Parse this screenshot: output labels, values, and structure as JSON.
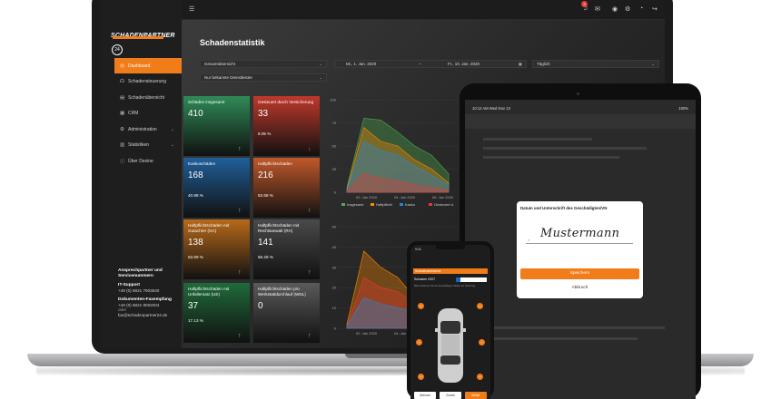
{
  "app": {
    "brand_name": "SCHADENPARTNER",
    "brand_badge": "24",
    "page_title": "Schadenstatistik"
  },
  "sidebar": {
    "items": [
      {
        "label": "Dashboard",
        "icon": "speedometer-icon",
        "glyph": "◷",
        "active": true
      },
      {
        "label": "Schadensteuerung",
        "icon": "headset-icon",
        "glyph": "☊",
        "active": false
      },
      {
        "label": "Schadenübersicht",
        "icon": "document-icon",
        "glyph": "▤",
        "active": false
      },
      {
        "label": "CRM",
        "icon": "contacts-icon",
        "glyph": "▦",
        "active": false
      },
      {
        "label": "Administration",
        "icon": "gear-icon",
        "glyph": "⚙",
        "active": false,
        "has_chevron": true
      },
      {
        "label": "Statistiken",
        "icon": "bar-chart-icon",
        "glyph": "▥",
        "active": false,
        "has_chevron": true
      },
      {
        "label": "Über Dexine",
        "icon": "info-icon",
        "glyph": "ⓘ",
        "active": false
      }
    ]
  },
  "contact": {
    "heading": "Ansprechpartner und Servicenummern",
    "it_label": "IT-Support",
    "it_phone": "+49 (0) 6821 7903540",
    "doc_label": "Dokumenten-Faxempfang",
    "doc_phone": "+49 (0) 6821 9002004",
    "or": "oder",
    "email": "fax@schadenpartner24.de"
  },
  "filters": {
    "overview": "Gesamtübersicht",
    "service": "Nur bekannte Dienstleister",
    "date_from": "Mi., 1. Jan. 2020",
    "date_sep": "–",
    "date_to": "Fr., 10. Jan. 2020",
    "interval": "Täglich"
  },
  "kpis": [
    {
      "title": "Schäden insgesamt",
      "value": "410",
      "percent": "",
      "color": "#2e8b57",
      "trend": "↑"
    },
    {
      "title": "Gesteuert durch Versicherung",
      "value": "33",
      "percent": "8.05 %",
      "color": "#c0392b",
      "trend": "↓"
    },
    {
      "title": "Kaskoschäden",
      "value": "168",
      "percent": "40.98 %",
      "color": "#1f5f99",
      "trend": "↑"
    },
    {
      "title": "Haftpflichtschäden",
      "value": "216",
      "percent": "52.68 %",
      "color": "#c0582a",
      "trend": "↑"
    },
    {
      "title": "Haftpflichtschäden mit Gutachter (GA)",
      "value": "138",
      "percent": "63.89 %",
      "color": "#b86a1a",
      "trend": "↑"
    },
    {
      "title": "Haftpflichtschäden mit Rechtsanwalt (RA)",
      "value": "141",
      "percent": "65.28 %",
      "color": "#4a4a4a",
      "trend": "↑"
    },
    {
      "title": "Haftpflichtschäden mit Unfallersatz (UE)",
      "value": "37",
      "percent": "17.13 %",
      "color": "#1f6b3a",
      "trend": "↑"
    },
    {
      "title": "Haftpflichtschäden pro Werkstattdurchlauf (WDL)",
      "value": "0",
      "percent": "",
      "color": "#5a5a5a",
      "trend": "↑"
    }
  ],
  "chart_data": [
    {
      "type": "area",
      "title": "",
      "x": [
        "02. Jan 2020",
        "04. Jan 2020",
        "06. Jan 2020"
      ],
      "ylim": [
        0,
        100
      ],
      "yticks": [
        "100",
        "75",
        "50",
        "25",
        "0"
      ],
      "series": [
        {
          "name": "Insgesamt",
          "color": "#4caf50",
          "values": [
            5,
            80,
            78,
            65,
            50,
            40,
            20
          ]
        },
        {
          "name": "Haftpflicht",
          "color": "#ff8a00",
          "values": [
            3,
            70,
            55,
            50,
            35,
            25,
            10
          ]
        },
        {
          "name": "Kasko",
          "color": "#1e88e5",
          "values": [
            2,
            55,
            45,
            40,
            28,
            18,
            8
          ]
        },
        {
          "name": "Gesteuert d.",
          "color": "#e53935",
          "values": [
            1,
            20,
            15,
            12,
            8,
            5,
            2
          ]
        }
      ],
      "legend": "bottom"
    },
    {
      "type": "area",
      "title": "",
      "x": [
        "02. Jan 2020",
        "04. Jan 2020"
      ],
      "ylim": [
        0,
        50
      ],
      "yticks": [
        "50",
        "40",
        "30",
        "20",
        "10",
        "0"
      ],
      "series": [
        {
          "name": "A",
          "color": "#ff8a00",
          "values": [
            2,
            38,
            30,
            25,
            15,
            8,
            2
          ]
        },
        {
          "name": "B",
          "color": "#e53935",
          "values": [
            1,
            25,
            20,
            18,
            12,
            6,
            1
          ]
        },
        {
          "name": "C",
          "color": "#1e88e5",
          "values": [
            1,
            15,
            12,
            10,
            8,
            4,
            1
          ]
        }
      ],
      "legend": "none"
    }
  ],
  "tablet": {
    "status_time": "10:12 AM  Wed Nov 13",
    "status_battery": "100%",
    "modal_title": "Datum und Unterschrift des Geschädigten/VN",
    "signature": "Mustermann",
    "save_label": "Speichern",
    "cancel_label": "Abbruch"
  },
  "phone": {
    "status": "9:41",
    "header": "Schadenaufnahme",
    "subtitle": "Schaden 2207",
    "body_text": "Bitte markieren Sie die beschädigten Stellen am Fahrzeug.",
    "btn_cancel": "Abbruch",
    "btn_back": "Zurück",
    "btn_next": "Weiter"
  }
}
